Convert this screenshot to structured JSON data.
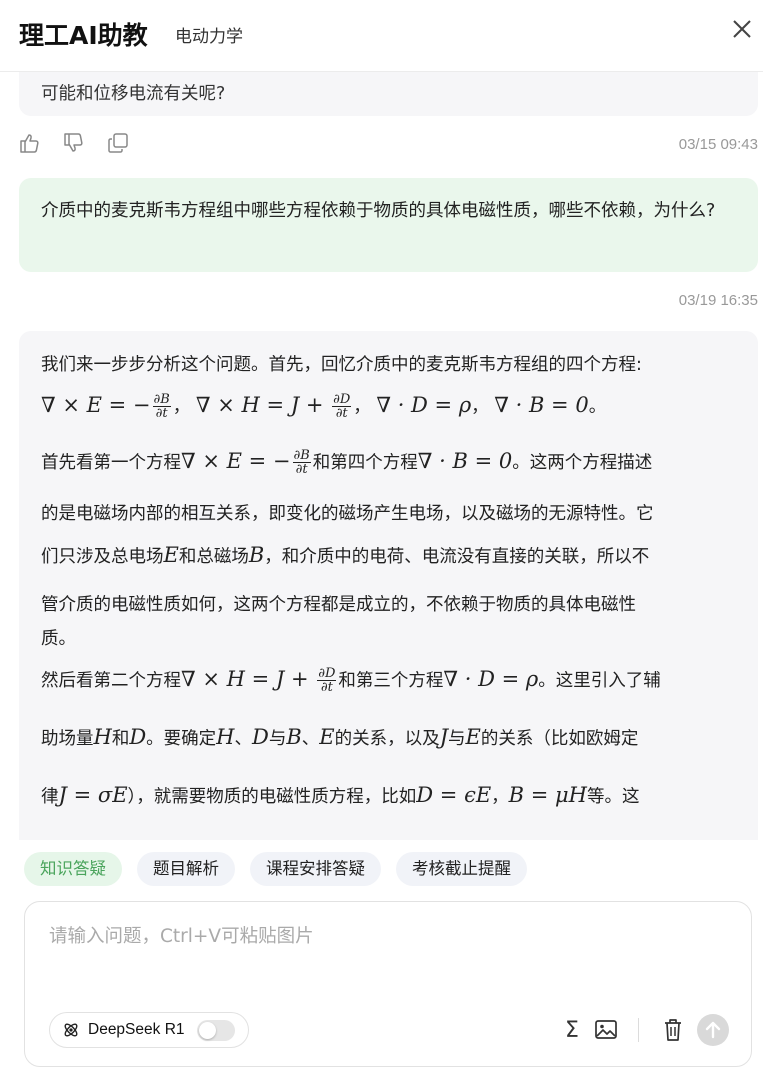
{
  "header": {
    "app_title": "理工AI助教",
    "subject": "电动力学"
  },
  "messages": {
    "prev_answer_tail": "可能和位移电流有关呢?",
    "prev_time": "03/15 09:43",
    "user_question": "介质中的麦克斯韦方程组中哪些方程依赖于物质的具体电磁性质，哪些不依赖，为什么?",
    "user_time": "03/19 16:35"
  },
  "answer": {
    "intro": "我们来一步步分析这个问题。首先，回忆介质中的麦克斯韦方程组的四个方程:",
    "eq_comma": "，",
    "eq_period": "。",
    "p1_a": "首先看第一个方程",
    "p1_b": "和第四个方程",
    "p1_c": "。这两个方程描述",
    "p1_line2": "的是电磁场内部的相互关系，即变化的磁场产生电场，以及磁场的无源特性。它",
    "p1_l3_a": "们只涉及总电场",
    "p1_l3_b": "和总磁场",
    "p1_l3_c": "，和介质中的电荷、电流没有直接的关联，所以不",
    "p1_line4": "管介质的电磁性质如何，这两个方程都是成立的，不依赖于物质的具体电磁性",
    "p1_line5": "质。",
    "p2_a": "然后看第二个方程",
    "p2_b": "和第三个方程",
    "p2_c": "。这里引入了辅",
    "p2_l2_a": "助场量",
    "p2_l2_b": "和",
    "p2_l2_c": "。要确定",
    "p2_l2_d": "、",
    "p2_l2_e": "与",
    "p2_l2_f": "、",
    "p2_l2_g": "的关系，以及",
    "p2_l2_h": "与",
    "p2_l2_i": "的关系（比如欧姆定",
    "p2_l3_a": "律",
    "p2_l3_b": "），就需要物质的电磁性质方程，比如",
    "p2_l3_c": "，",
    "p2_l3_d": "等。这",
    "sym_E": "E",
    "sym_H": "H",
    "sym_D": "D",
    "sym_B": "B",
    "sym_J": "J",
    "eq_ohm": "J = σE",
    "eq_D": "D = ϵE",
    "eq_B": "B = μH"
  },
  "tags": [
    "知识答疑",
    "题目解析",
    "课程安排答疑",
    "考核截止提醒"
  ],
  "input": {
    "placeholder": "请输入问题，Ctrl+V可粘贴图片",
    "model_name": "DeepSeek R1",
    "deep_think_enabled": false,
    "sigma": "Σ"
  },
  "colors": {
    "user_bubble": "#eaf7ec",
    "answer_bubble": "#f6f6f8",
    "accent_green": "#4aa45c"
  }
}
